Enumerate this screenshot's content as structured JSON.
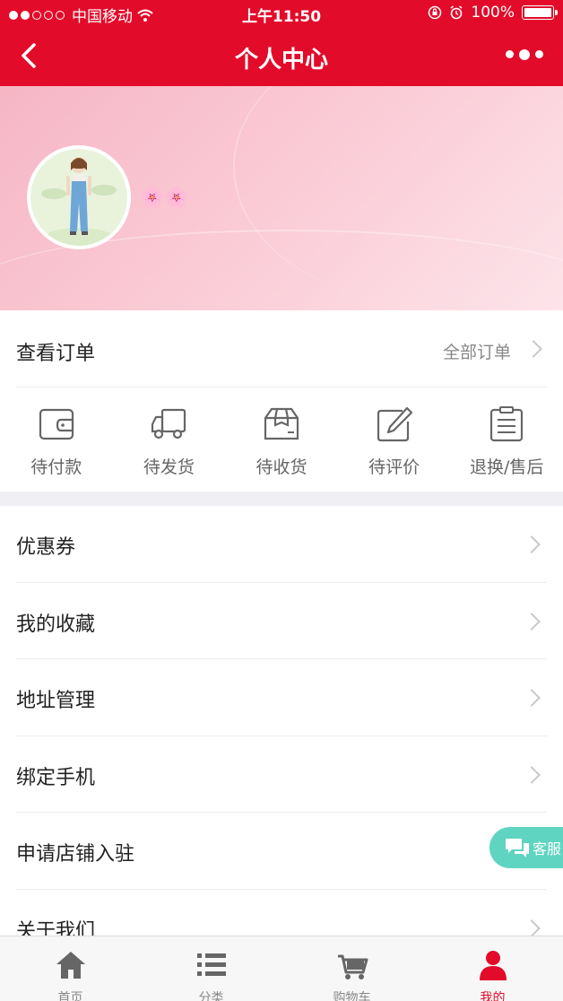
{
  "status_bar": {
    "carrier": "中国移动",
    "time": "上午11:50",
    "battery": "100%"
  },
  "nav": {
    "title": "个人中心"
  },
  "profile": {
    "nickname": "🌸🌸"
  },
  "orders": {
    "title": "查看订单",
    "all_label": "全部订单",
    "items": [
      {
        "label": "待付款",
        "icon": "wallet-icon"
      },
      {
        "label": "待发货",
        "icon": "truck-icon"
      },
      {
        "label": "待收货",
        "icon": "package-icon"
      },
      {
        "label": "待评价",
        "icon": "edit-icon"
      },
      {
        "label": "退换/售后",
        "icon": "clipboard-icon"
      }
    ]
  },
  "menu": [
    {
      "label": "优惠券"
    },
    {
      "label": "我的收藏"
    },
    {
      "label": "地址管理"
    },
    {
      "label": "绑定手机"
    },
    {
      "label": "申请店铺入驻"
    },
    {
      "label": "关于我们"
    }
  ],
  "customer_service": {
    "label": "客服"
  },
  "tabbar": {
    "items": [
      {
        "label": "首页",
        "icon": "home-icon"
      },
      {
        "label": "分类",
        "icon": "list-icon"
      },
      {
        "label": "购物车",
        "icon": "cart-icon"
      },
      {
        "label": "我的",
        "icon": "user-icon"
      }
    ],
    "active_index": 3
  },
  "colors": {
    "brand_red": "#e30b2a",
    "service_teal": "#5fd4c0",
    "banner_pink": "#f6b6c4"
  }
}
